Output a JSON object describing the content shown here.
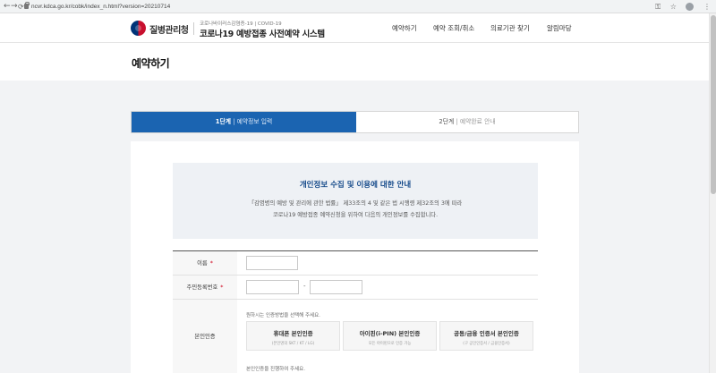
{
  "browser": {
    "back_icon": "←",
    "forward_icon": "→",
    "reload_icon": "⟳",
    "url": "ncvr.kdca.go.kr/cobk/index_n.html?version=20210714",
    "key_icon": "⚿",
    "star_icon": "☆",
    "menu_icon": "⋮"
  },
  "header": {
    "agency_name": "질병관리청",
    "system_sub": "코로나바이러스감염증-19 | COVID-19",
    "system_title": "코로나19 예방접종 사전예약 시스템",
    "nav": [
      "예약하기",
      "예약 조회/취소",
      "의료기관 찾기",
      "알림마당"
    ]
  },
  "page": {
    "title": "예약하기"
  },
  "steps": {
    "step1_num": "1단계",
    "step1_sep": " | ",
    "step1_label": "예약정보 입력",
    "step2_num": "2단계",
    "step2_sep": " | ",
    "step2_label": "예약완료 안내"
  },
  "notice": {
    "title": "개인정보 수집 및 이용에 대한 안내",
    "line1": "「감염병의 예방 및 관리에 관한 법률」 제33조의 4 및 같은 법 시행령 제32조의 3에 따라",
    "line2": "코로나19 예방접종 예약신청을 위하여 다음의 개인정보를 수집합니다."
  },
  "form": {
    "name_label": "이름",
    "rrn_label": "주민등록번호",
    "rrn_dash": "-",
    "auth_label": "본인인증",
    "required_mark": "*",
    "auth_hint": "원하시는 인증방법을 선택해 주세요.",
    "auth_options": [
      {
        "title": "휴대폰 본인인증",
        "sub": "(본인명의 SKT / KT / LG)"
      },
      {
        "title": "아이핀(i-PIN) 본인인증",
        "sub": "모든 아이핀으로 인증 가능"
      },
      {
        "title": "공동/금융 인증서 본인인증",
        "sub": "(구 공인인증서 / 금융인증서)"
      }
    ],
    "after_hint": "본인인증을 진행하여 주세요."
  }
}
